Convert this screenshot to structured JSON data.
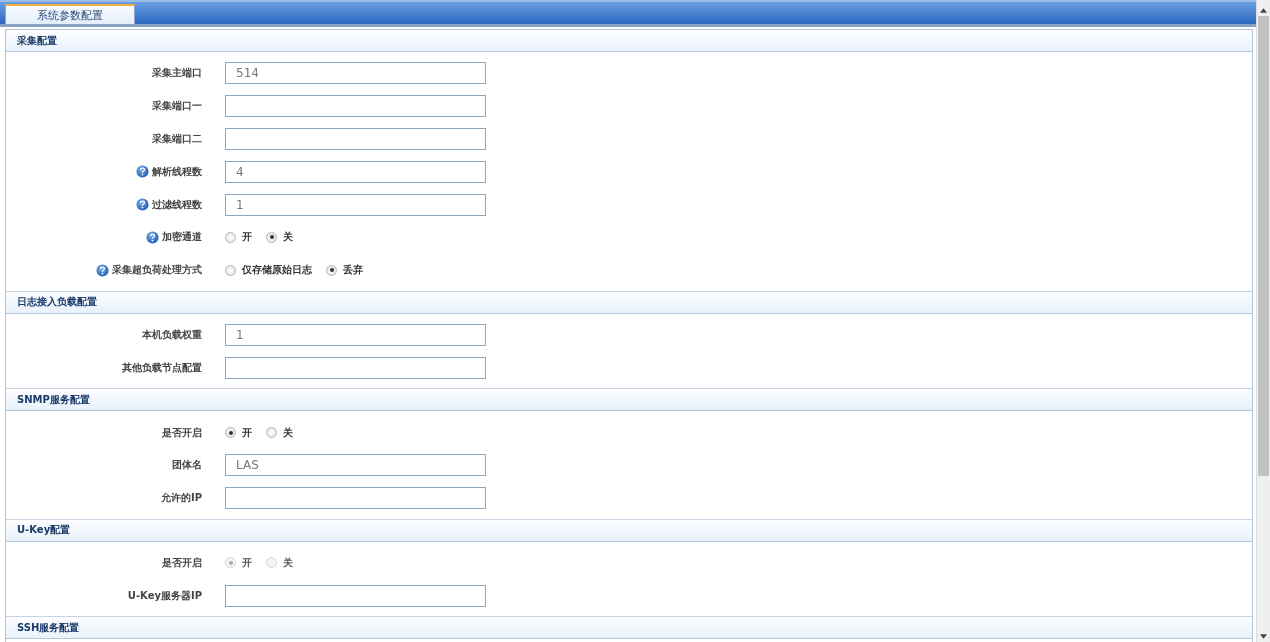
{
  "tabs": [
    {
      "label": "系统参数配置",
      "selected": true
    }
  ],
  "sections": [
    {
      "title": "采集配置",
      "fields": [
        {
          "kind": "text",
          "label": "采集主端口",
          "value": "514"
        },
        {
          "kind": "text",
          "label": "采集端口一"
        },
        {
          "kind": "text",
          "label": "采集端口二"
        },
        {
          "kind": "text",
          "label": "解析线程数",
          "help": true,
          "value": "4"
        },
        {
          "kind": "text",
          "label": "过滤线程数",
          "help": true,
          "value": "1"
        },
        {
          "kind": "radio",
          "label": "加密通道",
          "help": true,
          "disabled": false,
          "options": [
            {
              "label": "开",
              "selected": false
            },
            {
              "label": "关",
              "selected": true
            }
          ]
        },
        {
          "kind": "radio",
          "label": "采集超负荷处理方式",
          "help": true,
          "disabled": false,
          "options": [
            {
              "label": "仅存储原始日志",
              "selected": false
            },
            {
              "label": "丢弃",
              "selected": true
            }
          ]
        }
      ]
    },
    {
      "title": "日志接入负载配置",
      "fields": [
        {
          "kind": "text",
          "label": "本机负载权重",
          "value": "1"
        },
        {
          "kind": "text",
          "label": "其他负载节点配置"
        }
      ]
    },
    {
      "title": "SNMP服务配置",
      "fields": [
        {
          "kind": "radio",
          "label": "是否开启",
          "disabled": false,
          "options": [
            {
              "label": "开",
              "selected": true
            },
            {
              "label": "关",
              "selected": false
            }
          ]
        },
        {
          "kind": "text",
          "label": "团体名",
          "value": "LAS"
        },
        {
          "kind": "text",
          "label": "允许的IP"
        }
      ]
    },
    {
      "title": "U-Key配置",
      "fields": [
        {
          "kind": "radio",
          "label": "是否开启",
          "disabled": true,
          "options": [
            {
              "label": "开",
              "selected": true
            },
            {
              "label": "关",
              "selected": false
            }
          ]
        },
        {
          "kind": "text",
          "label": "U-Key服务器IP"
        }
      ]
    },
    {
      "title": "SSH服务配置"
    }
  ]
}
